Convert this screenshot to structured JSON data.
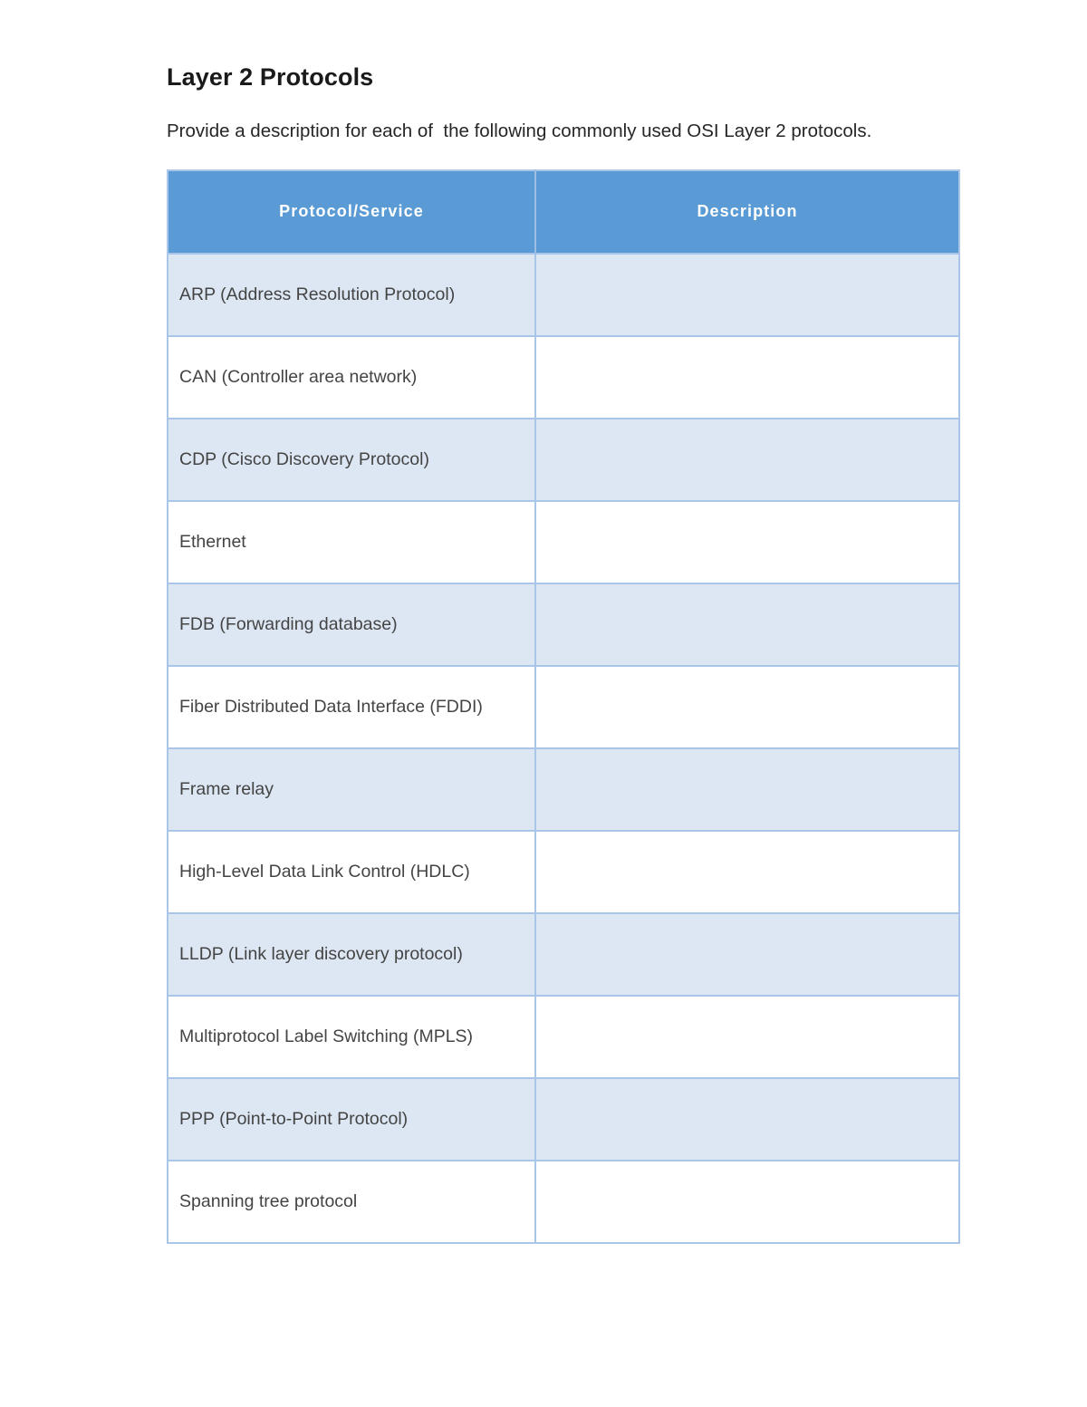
{
  "document": {
    "title": "Layer 2 Protocols",
    "intro": "Provide a description for each of  the following commonly used OSI Layer 2 protocols."
  },
  "table": {
    "headers": {
      "protocol": "Protocol/Service",
      "description": "Description"
    },
    "colors": {
      "header_background": "#5b9bd5",
      "header_text": "#ffffff",
      "band_row_background": "#dde7f3",
      "plain_row_background": "#ffffff",
      "border": "#a9c6e8",
      "body_text": "#444444"
    },
    "rows": [
      {
        "protocol": "ARP (Address Resolution Protocol)",
        "description": ""
      },
      {
        "protocol": "CAN (Controller area network)",
        "description": ""
      },
      {
        "protocol": "CDP (Cisco Discovery Protocol)",
        "description": ""
      },
      {
        "protocol": "Ethernet",
        "description": ""
      },
      {
        "protocol": "FDB (Forwarding database)",
        "description": ""
      },
      {
        "protocol": "Fiber Distributed Data Interface (FDDI)",
        "description": ""
      },
      {
        "protocol": "Frame relay",
        "description": ""
      },
      {
        "protocol": "High-Level Data Link Control (HDLC)",
        "description": ""
      },
      {
        "protocol": "LLDP (Link layer discovery protocol)",
        "description": ""
      },
      {
        "protocol": "Multiprotocol Label Switching (MPLS)",
        "description": ""
      },
      {
        "protocol": "PPP (Point-to-Point Protocol)",
        "description": ""
      },
      {
        "protocol": "Spanning tree protocol",
        "description": ""
      }
    ]
  }
}
